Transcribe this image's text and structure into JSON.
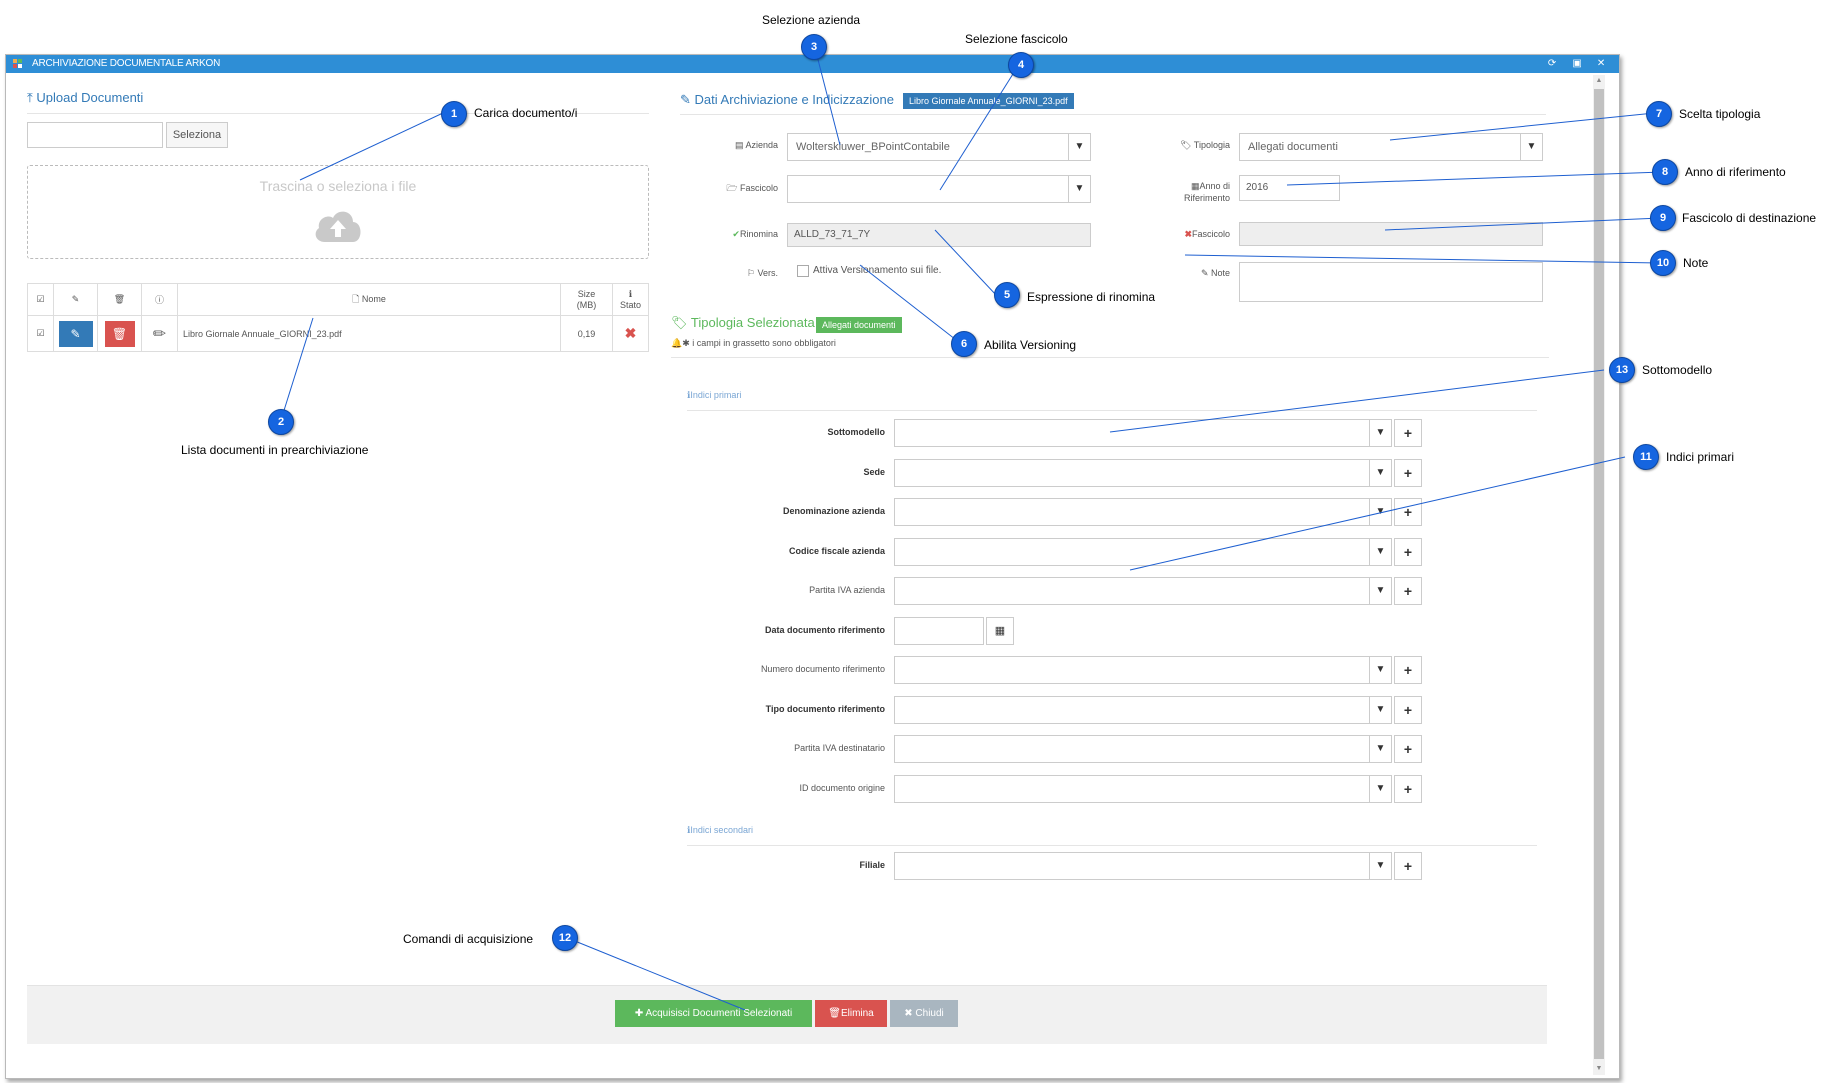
{
  "window": {
    "title": "ARCHIVIAZIONE DOCUMENTALE ARKON",
    "controls": [
      "refresh-icon",
      "maximize-icon",
      "close-icon"
    ]
  },
  "upload": {
    "title": "Upload Documenti",
    "select_button": "Seleziona",
    "dropzone_text": "Trascina o seleziona i file",
    "table": {
      "headers": {
        "name": "Nome",
        "size": "Size (MB)",
        "size_line1": "Size",
        "size_line2": "(MB)",
        "status": "Stato"
      },
      "rows": [
        {
          "name": "Libro Giornale Annuale_GIORNI_23.pdf",
          "size": "0,19"
        }
      ]
    }
  },
  "archive": {
    "title": "Dati Archiviazione e Indicizzazione",
    "file_tag": "Libro Giornale Annuale_GIORNI_23.pdf",
    "azienda_label": "Azienda",
    "azienda_value": "Wolterskluwer_BPointContabile",
    "fascicolo_label": "Fascicolo",
    "fascicolo_value": "",
    "rinomina_label": "Rinomina",
    "rinomina_value": "ALLD_73_71_7Y",
    "vers_label": "Vers.",
    "vers_checkbox": "Attiva Versionamento sui file.",
    "tipologia_label": "Tipologia",
    "tipologia_value": "Allegati documenti",
    "anno_label_1": "Anno di",
    "anno_label_2": "Riferimento",
    "anno_value": "2016",
    "fascicolo_dest_label": "Fascicolo",
    "note_label": "Note"
  },
  "tipologia": {
    "title": "Tipologia Selezionata",
    "tag": "Allegati documenti",
    "required_note": "i campi in grassetto sono obbligatori",
    "primary_section": "Indici primari",
    "secondary_section": "Indici secondari",
    "primary_fields": [
      {
        "label": "Sottomodello",
        "bold": true
      },
      {
        "label": "Sede",
        "bold": true
      },
      {
        "label": "Denominazione azienda",
        "bold": true
      },
      {
        "label": "Codice fiscale azienda",
        "bold": true
      },
      {
        "label": "Partita IVA azienda",
        "bold": false
      },
      {
        "label": "Data documento riferimento",
        "bold": true
      },
      {
        "label": "Numero documento riferimento",
        "bold": false
      },
      {
        "label": "Tipo documento riferimento",
        "bold": true
      },
      {
        "label": "Partita IVA destinatario",
        "bold": false
      },
      {
        "label": "ID documento origine",
        "bold": false
      }
    ],
    "secondary_fields": [
      {
        "label": "Filiale",
        "bold": true
      }
    ]
  },
  "footer": {
    "acquisisci": "Acquisisci Documenti Selezionati",
    "elimina": "Elimina",
    "chiudi": "Chiudi"
  },
  "annotations": [
    {
      "n": "1",
      "label": "Carica documento/i"
    },
    {
      "n": "2",
      "label": "Lista documenti in prearchiviazione"
    },
    {
      "n": "3",
      "label": "Selezione azienda"
    },
    {
      "n": "4",
      "label": "Selezione fascicolo"
    },
    {
      "n": "5",
      "label": "Espressione di rinomina"
    },
    {
      "n": "6",
      "label": "Abilita Versioning"
    },
    {
      "n": "7",
      "label": "Scelta tipologia"
    },
    {
      "n": "8",
      "label": "Anno di riferimento"
    },
    {
      "n": "9",
      "label": "Fascicolo di destinazione"
    },
    {
      "n": "10",
      "label": "Note"
    },
    {
      "n": "11",
      "label": "Indici primari"
    },
    {
      "n": "12",
      "label": "Comandi di acquisizione"
    },
    {
      "n": "13",
      "label": "Sottomodello"
    }
  ],
  "colors": {
    "titlebar": "#2e8ed6",
    "link": "#337ab7",
    "success": "#5cb85c",
    "danger": "#d9534f",
    "callout": "#1565e0"
  }
}
